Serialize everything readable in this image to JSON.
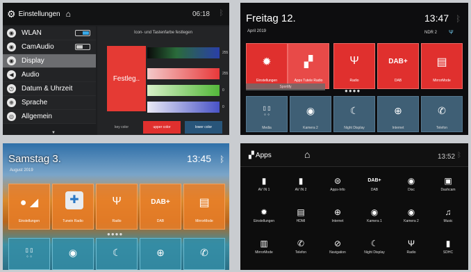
{
  "panel1": {
    "title": "Einstellungen",
    "time": "06:18",
    "menu": [
      {
        "label": "WLAN",
        "icon": "wifi-icon",
        "toggle": "on"
      },
      {
        "label": "CamAudio",
        "icon": "camaudio-icon",
        "toggle": "off"
      },
      {
        "label": "Display",
        "icon": "display-icon",
        "active": true
      },
      {
        "label": "Audio",
        "icon": "audio-icon"
      },
      {
        "label": "Datum & Uhrzeit",
        "icon": "clock-icon"
      },
      {
        "label": "Sprache",
        "icon": "language-icon"
      },
      {
        "label": "Allgemein",
        "icon": "general-icon"
      }
    ],
    "content_heading": "Icon- und Tastenfarbe festlegen",
    "swatch_label": "Festleg..",
    "sliders": [
      {
        "value": "255"
      },
      {
        "value": "255"
      },
      {
        "value": "0"
      },
      {
        "value": "0"
      }
    ],
    "buttons": [
      "key color",
      "upper color",
      "lower color"
    ]
  },
  "panel2": {
    "date": "Freitag 12.",
    "sub": "April 2019",
    "time": "13:47",
    "station": "NDR 2",
    "top_tiles": [
      {
        "label": "Einstellungen",
        "icon": "gear-icon"
      },
      {
        "label": "Apps Tutele Radio",
        "icon": "apps-icon"
      },
      {
        "label": "Radio",
        "icon": "radio-icon"
      },
      {
        "label": "DAB",
        "icon": "dab-icon"
      },
      {
        "label": "MirrorMode",
        "icon": "mirror-icon"
      }
    ],
    "sport_label": "Sportify",
    "bottom_tiles": [
      {
        "label": "Media",
        "icon": "media-icon"
      },
      {
        "label": "Kamera 2",
        "icon": "camera-icon"
      },
      {
        "label": "Night Display",
        "icon": "night-icon"
      },
      {
        "label": "Internet",
        "icon": "globe-icon"
      },
      {
        "label": "Telefon",
        "icon": "phone-icon"
      }
    ]
  },
  "panel3": {
    "date": "Samstag 3.",
    "sub": "August 2019",
    "time": "13:45",
    "top_tiles": [
      {
        "label": "Einstellungen"
      },
      {
        "label": "Tunein Radio"
      },
      {
        "label": "Radio"
      },
      {
        "label": "DAB"
      },
      {
        "label": "MirrorMode"
      }
    ]
  },
  "panel4": {
    "title": "Apps",
    "time": "13:52",
    "apps": [
      {
        "label": "AV IN 1",
        "icon": "av-in-icon"
      },
      {
        "label": "AV IN 2",
        "icon": "av-in-icon"
      },
      {
        "label": "Apps-Info",
        "icon": "apps-info-icon"
      },
      {
        "label": "DAB",
        "icon": "dab-icon"
      },
      {
        "label": "Disc",
        "icon": "disc-icon"
      },
      {
        "label": "Dashcam",
        "icon": "dashcam-icon"
      },
      {
        "label": "Einstellungen",
        "icon": "gear-icon"
      },
      {
        "label": "HDMI",
        "icon": "hdmi-icon"
      },
      {
        "label": "Internet",
        "icon": "globe-icon"
      },
      {
        "label": "Kamera 1",
        "icon": "camera-icon"
      },
      {
        "label": "Kamera 2",
        "icon": "camera-icon"
      },
      {
        "label": "Music",
        "icon": "music-icon"
      },
      {
        "label": "MirrorMode",
        "icon": "mirror-icon"
      },
      {
        "label": "Telefon",
        "icon": "phone-icon"
      },
      {
        "label": "Navigation",
        "icon": "navigation-icon"
      },
      {
        "label": "Night Display",
        "icon": "night-icon"
      },
      {
        "label": "Radio",
        "icon": "radio-icon"
      },
      {
        "label": "SDHC",
        "icon": "sdcard-icon"
      }
    ]
  }
}
